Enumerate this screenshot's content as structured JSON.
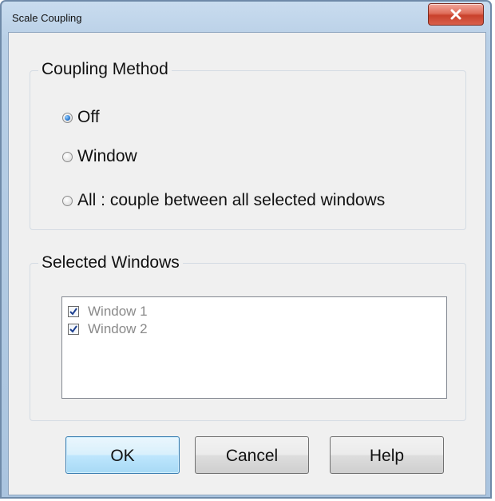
{
  "window": {
    "title": "Scale Coupling"
  },
  "coupling_method": {
    "group_title": "Coupling Method",
    "options": [
      {
        "label": "Off",
        "checked": true
      },
      {
        "label": "Window",
        "checked": false
      },
      {
        "label": "All : couple between all selected windows",
        "checked": false
      }
    ]
  },
  "selected_windows": {
    "group_title": "Selected Windows",
    "items": [
      {
        "label": "Window 1",
        "checked": true
      },
      {
        "label": "Window 2",
        "checked": true
      }
    ]
  },
  "buttons": {
    "ok": "OK",
    "cancel": "Cancel",
    "help": "Help"
  },
  "colors": {
    "close_button": "#c9412c",
    "default_button_border": "#3c7fb1",
    "frame": "#aac4df"
  },
  "icons": {
    "close": "close-icon",
    "check": "check-icon"
  }
}
